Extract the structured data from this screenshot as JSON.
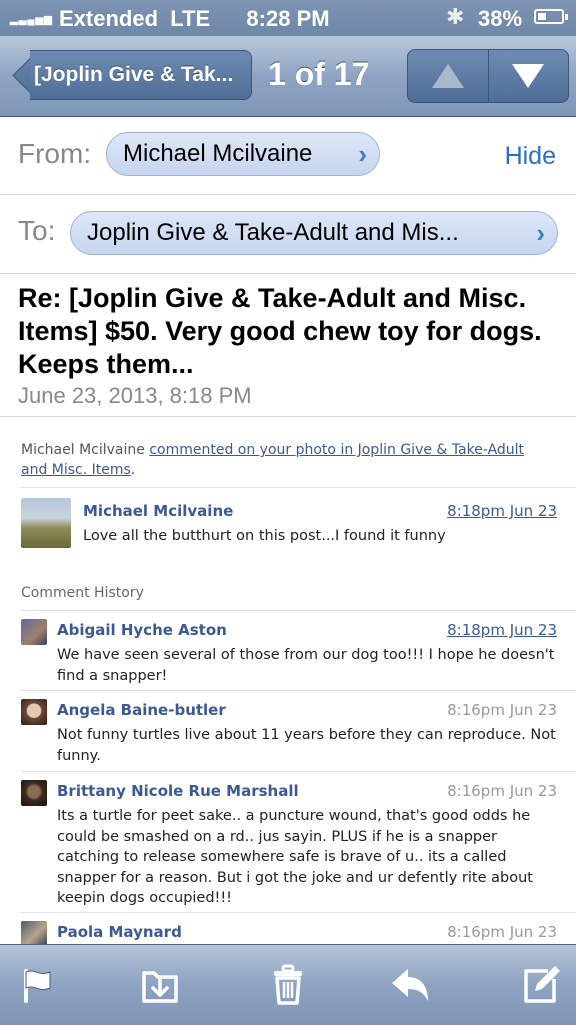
{
  "status_bar": {
    "carrier": "Extended",
    "network": "LTE",
    "time": "8:28 PM",
    "battery": "38%",
    "battery_level": 0.38
  },
  "nav": {
    "back_label": "[Joplin Give & Tak...",
    "counter": "1 of 17"
  },
  "header": {
    "from_label": "From:",
    "from_value": "Michael Mcilvaine",
    "hide_label": "Hide",
    "to_label": "To:",
    "to_value": "Joplin Give & Take-Adult and Mis...",
    "subject": "Re: [Joplin Give & Take-Adult and Misc. Items] $50. Very good chew toy for dogs. Keeps them...",
    "date": "June 23, 2013, 8:18 PM"
  },
  "body": {
    "intro_name": "Michael Mcilvaine",
    "intro_link": "commented on your photo in Joplin Give & Take-Adult and Misc. Items",
    "intro_end": ".",
    "main_comment": {
      "name": "Michael Mcilvaine",
      "time": "8:18pm Jun 23",
      "text": "Love all the butthurt on this post...I found it funny"
    },
    "history_label": "Comment History",
    "history": [
      {
        "name": "Abigail Hyche Aston",
        "time": "8:18pm Jun 23",
        "text": "We have seen several of those from our dog too!!! I hope he doesn't find a snapper!"
      },
      {
        "name": "Angela Baine-butler",
        "time": "8:16pm Jun 23",
        "text": "Not funny turtles live about 11 years before they can reproduce. Not funny."
      },
      {
        "name": "Brittany Nicole Rue Marshall",
        "time": "8:16pm Jun 23",
        "text": "Its a turtle for peet sake.. a puncture wound, that's good odds he could be smashed on a rd.. jus sayin. PLUS if he is a snapper catching to release somewhere safe is brave of u.. its a called snapper for a reason. But i got the joke and ur defently rite about keepin dogs occupied!!!"
      },
      {
        "name": "Paola Maynard",
        "time": "8:16pm Jun 23",
        "text": ""
      }
    ]
  },
  "toolbar": {
    "icons": [
      "flag-icon",
      "move-to-folder-icon",
      "trash-icon",
      "reply-icon",
      "compose-icon"
    ]
  },
  "colors": {
    "link": "#3b5998",
    "accent": "#2a6fd0",
    "nav_bar": "#8ea4c2"
  }
}
